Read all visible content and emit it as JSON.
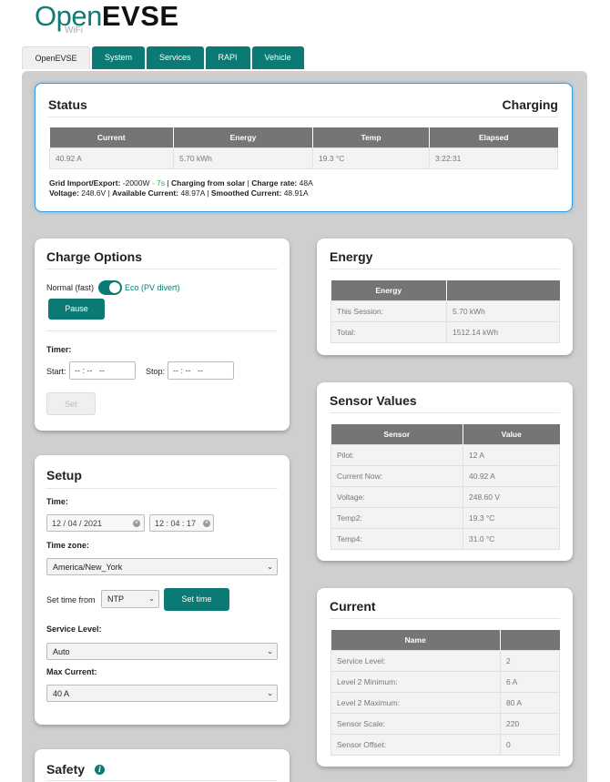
{
  "brand": {
    "open": "Open",
    "evse": "EVSE",
    "wifi": "WiFi"
  },
  "tabs": [
    "OpenEVSE",
    "System",
    "Services",
    "RAPI",
    "Vehicle"
  ],
  "status": {
    "title": "Status",
    "state": "Charging",
    "columns": [
      "Current",
      "Energy",
      "Temp",
      "Elapsed"
    ],
    "values": [
      "40.92 A",
      "5.70 kWh",
      "19.3 °C",
      "3:22:31"
    ],
    "grid_label": "Grid Import/Export:",
    "grid_value": "-2000W",
    "grid_age": "7s",
    "solar_label": "Charging from solar",
    "rate_label": "Charge rate:",
    "rate_value": "48A",
    "voltage_label": "Voltage:",
    "voltage_value": "248.6V",
    "avail_label": "Available Current:",
    "avail_value": "48.97A",
    "smoothed_label": "Smoothed Current:",
    "smoothed_value": "48.91A",
    "sep": " | ",
    "dash": " - "
  },
  "charge_options": {
    "title": "Charge Options",
    "mode_fast": "Normal (fast)",
    "mode_eco": "Eco (PV divert)",
    "pause": "Pause",
    "timer": "Timer:",
    "start_label": "Start:",
    "start_value": "-- : --   --",
    "stop_label": "Stop:",
    "stop_value": "-- : --   --",
    "set": "Set"
  },
  "setup": {
    "title": "Setup",
    "time_label": "Time:",
    "date_value": "12 / 04 / 2021",
    "time_value": "12 : 04 : 17",
    "tz_label": "Time zone:",
    "tz_value": "America/New_York",
    "set_from_label": "Set time from",
    "set_from_value": "NTP",
    "set_time": "Set time",
    "service_label": "Service Level:",
    "service_value": "Auto",
    "max_label": "Max Current:",
    "max_value": "40 A"
  },
  "safety": {
    "title": "Safety"
  },
  "energy": {
    "title": "Energy",
    "header": "Energy",
    "rows": [
      {
        "k": "This Session:",
        "v": "5.70 kWh"
      },
      {
        "k": "Total:",
        "v": "1512.14 kWh"
      }
    ]
  },
  "sensors": {
    "title": "Sensor Values",
    "h1": "Sensor",
    "h2": "Value",
    "rows": [
      {
        "k": "Pilot:",
        "v": "12 A"
      },
      {
        "k": "Current Now:",
        "v": "40.92 A"
      },
      {
        "k": "Voltage:",
        "v": "248.60 V"
      },
      {
        "k": "Temp2:",
        "v": "19.3 °C"
      },
      {
        "k": "Temp4:",
        "v": "31.0 °C"
      }
    ]
  },
  "current": {
    "title": "Current",
    "h1": "Name",
    "rows": [
      {
        "k": "Service Level:",
        "v": "2"
      },
      {
        "k": "Level 2 Minimum:",
        "v": "6 A"
      },
      {
        "k": "Level 2 Maximum:",
        "v": "80 A"
      },
      {
        "k": "Sensor Scale:",
        "v": "220"
      },
      {
        "k": "Sensor Offset:",
        "v": "0"
      }
    ]
  },
  "colors": {
    "accent": "#0b7a74",
    "status_border": "#3a9ee0",
    "green": "#3aa83a"
  }
}
